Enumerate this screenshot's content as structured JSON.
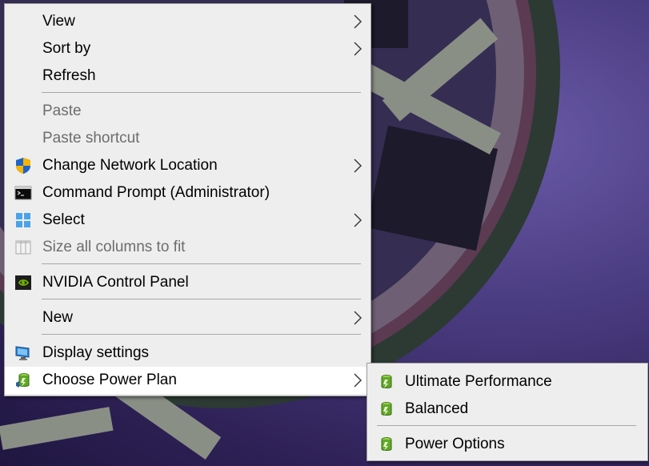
{
  "main_menu": {
    "view": "View",
    "sort_by": "Sort by",
    "refresh": "Refresh",
    "paste": "Paste",
    "paste_shortcut": "Paste shortcut",
    "change_network_location": "Change Network Location",
    "command_prompt_admin": "Command Prompt (Administrator)",
    "select": "Select",
    "size_all_columns": "Size all columns to fit",
    "nvidia_control_panel": "NVIDIA Control Panel",
    "new": "New",
    "display_settings": "Display settings",
    "choose_power_plan": "Choose Power Plan"
  },
  "power_submenu": {
    "ultimate_performance": "Ultimate Performance",
    "balanced": "Balanced",
    "power_options": "Power Options"
  },
  "icons": {
    "change_network_location": "uac-shield-icon",
    "command_prompt_admin": "command-prompt-icon",
    "select": "select-grid-icon",
    "size_all_columns": "columns-icon",
    "nvidia_control_panel": "nvidia-icon",
    "display_settings": "monitor-icon",
    "choose_power_plan": "power-plan-battery-icon",
    "submenu_arrow": "chevron-right-icon"
  },
  "colors": {
    "menu_background": "#eeeeee",
    "hover_background": "#ffffff",
    "disabled_text": "#6d6d6d",
    "separator": "#a7a7a7"
  }
}
